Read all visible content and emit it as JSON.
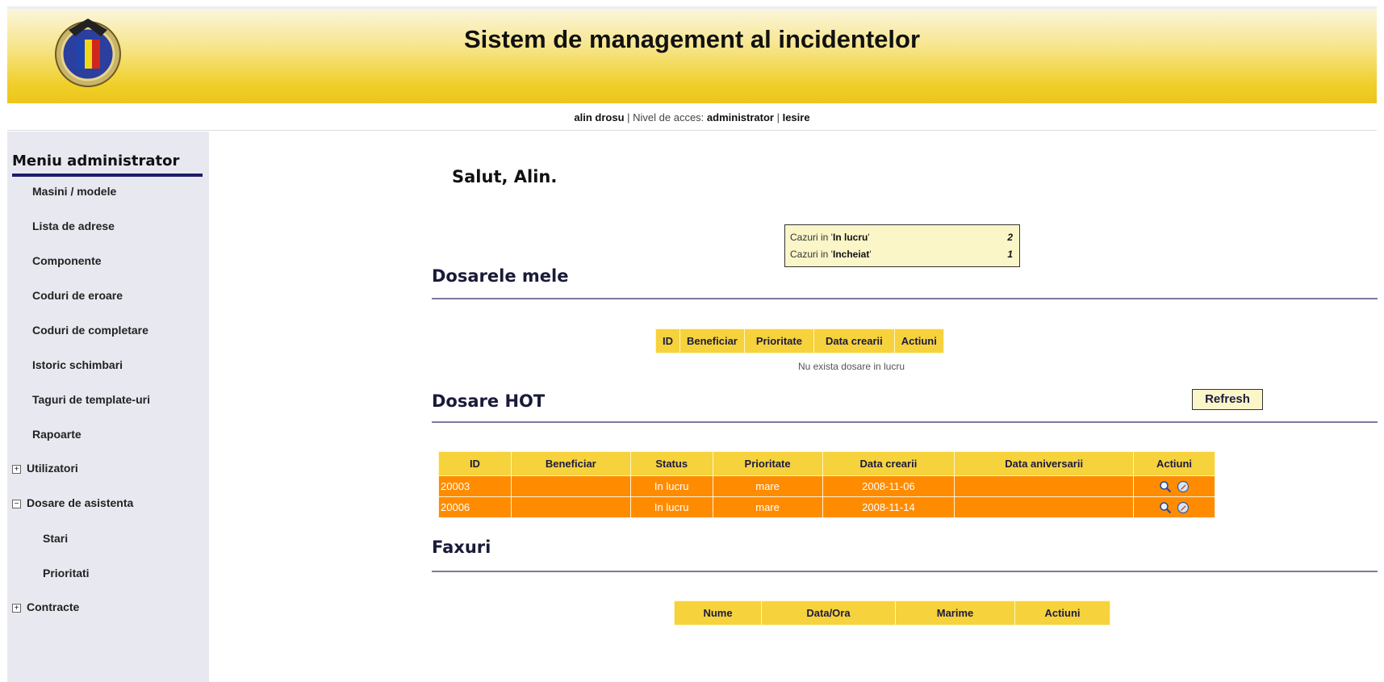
{
  "header": {
    "title": "Sistem de management al incidentelor"
  },
  "userbar": {
    "user": "alin drosu",
    "sep1": " | ",
    "access_label": "Nivel de acces: ",
    "access_level": "administrator",
    "sep2": " | ",
    "logout": "Iesire"
  },
  "sidebar": {
    "title": "Meniu administrator",
    "items": [
      {
        "label": "Masini / modele"
      },
      {
        "label": "Lista de adrese"
      },
      {
        "label": "Componente"
      },
      {
        "label": "Coduri de eroare"
      },
      {
        "label": "Coduri de completare"
      },
      {
        "label": "Istoric schimbari"
      },
      {
        "label": "Taguri de template-uri"
      },
      {
        "label": "Rapoarte"
      },
      {
        "label": "Utilizatori",
        "toggle": "+"
      },
      {
        "label": "Dosare de asistenta",
        "toggle": "−"
      },
      {
        "label": "Stari"
      },
      {
        "label": "Prioritati"
      },
      {
        "label": "Contracte",
        "toggle": "+"
      }
    ]
  },
  "main": {
    "greeting": "Salut, Alin.",
    "summary": {
      "row1_prefix": "Cazuri in '",
      "row1_status": "In lucru",
      "row1_suffix": "'",
      "row1_count": "2",
      "row2_prefix": "Cazuri in '",
      "row2_status": "Incheiat",
      "row2_suffix": "'",
      "row2_count": "1"
    },
    "my_files": {
      "title": "Dosarele mele",
      "columns": [
        "ID",
        "Beneficiar",
        "Prioritate",
        "Data crearii",
        "Actiuni"
      ],
      "empty_message": "Nu exista dosare in lucru"
    },
    "hot_files": {
      "title": "Dosare HOT",
      "refresh_label": "Refresh",
      "columns": [
        "ID",
        "Beneficiar",
        "Status",
        "Prioritate",
        "Data crearii",
        "Data aniversarii",
        "Actiuni"
      ],
      "rows": [
        {
          "id": "20003",
          "beneficiar": "",
          "status": "In lucru",
          "prioritate": "mare",
          "data_crearii": "2008-11-06",
          "data_aniversarii": ""
        },
        {
          "id": "20006",
          "beneficiar": "",
          "status": "In lucru",
          "prioritate": "mare",
          "data_crearii": "2008-11-14",
          "data_aniversarii": ""
        }
      ],
      "action_icons": [
        "magnifier-icon",
        "edit-icon"
      ]
    },
    "faxes": {
      "title": "Faxuri",
      "columns": [
        "Nume",
        "Data/Ora",
        "Marime",
        "Actiuni"
      ]
    }
  },
  "colors": {
    "header_yellow": "#f0cf2a",
    "table_header": "#f6d23c",
    "row_orange": "#ff8c00",
    "sidebar_bg": "#e8e8f0",
    "accent_navy": "#1d1d6b"
  }
}
